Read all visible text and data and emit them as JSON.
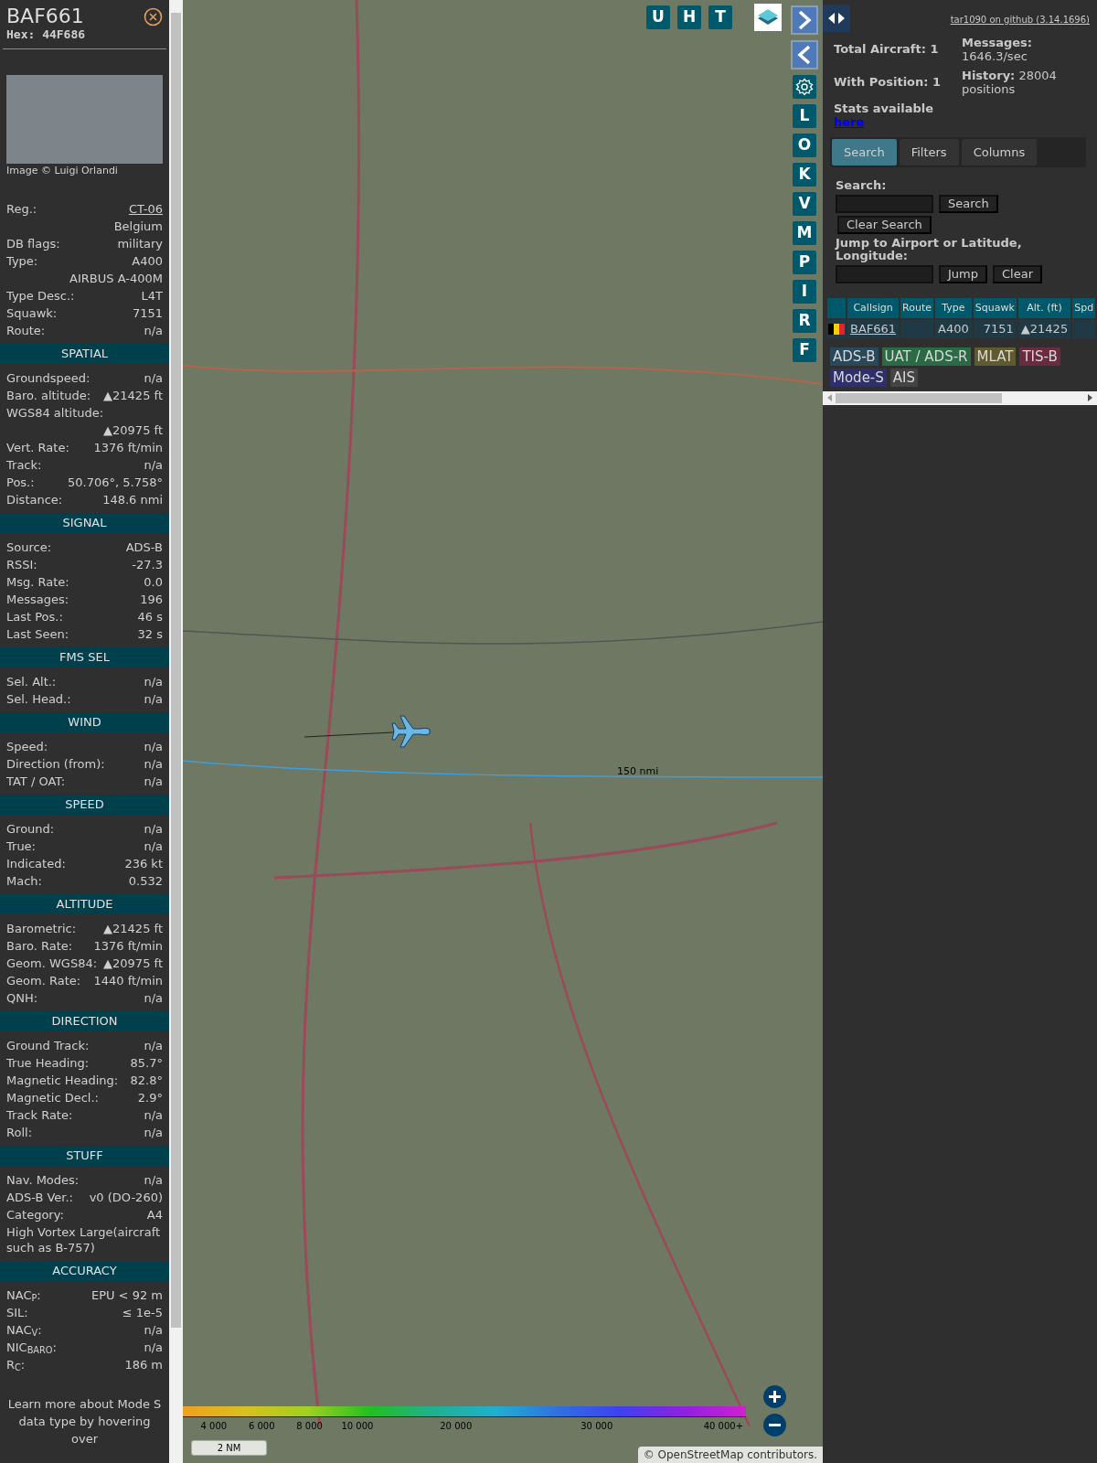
{
  "detail": {
    "callsign": "BAF661",
    "hex": "Hex: 44F686",
    "photo_credit": "Image © Luigi Orlandi",
    "rows": [
      {
        "label": "Reg.:",
        "value": "CT-06",
        "link": true
      },
      {
        "value": "Belgium"
      },
      {
        "label": "DB flags:",
        "value": "military"
      },
      {
        "label": "Type:",
        "value": "A400"
      },
      {
        "value": "AIRBUS A-400M"
      },
      {
        "label": "Type Desc.:",
        "value": "L4T"
      },
      {
        "label": "Squawk:",
        "value": "7151"
      },
      {
        "label": "Route:",
        "value": "n/a"
      }
    ],
    "sections": [
      {
        "title": "SPATIAL",
        "rows": [
          {
            "label": "Groundspeed:",
            "value": "n/a"
          },
          {
            "label": "Baro. altitude:",
            "value": "▲21425 ft"
          },
          {
            "label": "WGS84 altitude:"
          },
          {
            "value": "▲20975 ft"
          },
          {
            "label": "Vert. Rate:",
            "value": "1376 ft/min"
          },
          {
            "label": "Track:",
            "value": "n/a"
          },
          {
            "label": "Pos.:",
            "value": "50.706°, 5.758°"
          },
          {
            "label": "Distance:",
            "value": "148.6 nmi"
          }
        ]
      },
      {
        "title": "SIGNAL",
        "rows": [
          {
            "label": "Source:",
            "value": "ADS-B"
          },
          {
            "label": "RSSI:",
            "value": "-27.3"
          },
          {
            "label": "Msg. Rate:",
            "value": "0.0"
          },
          {
            "label": "Messages:",
            "value": "196"
          },
          {
            "label": "Last Pos.:",
            "value": "46 s"
          },
          {
            "label": "Last Seen:",
            "value": "32 s"
          }
        ]
      },
      {
        "title": "FMS SEL",
        "rows": [
          {
            "label": "Sel. Alt.:",
            "value": "n/a"
          },
          {
            "label": "Sel. Head.:",
            "value": "n/a"
          }
        ]
      },
      {
        "title": "WIND",
        "rows": [
          {
            "label": "Speed:",
            "value": "n/a"
          },
          {
            "label": "Direction (from):",
            "value": "n/a"
          },
          {
            "label": "TAT / OAT:",
            "value": "n/a"
          }
        ]
      },
      {
        "title": "SPEED",
        "rows": [
          {
            "label": "Ground:",
            "value": "n/a"
          },
          {
            "label": "True:",
            "value": "n/a"
          },
          {
            "label": "Indicated:",
            "value": "236 kt"
          },
          {
            "label": "Mach:",
            "value": "0.532"
          }
        ]
      },
      {
        "title": "ALTITUDE",
        "rows": [
          {
            "label": "Barometric:",
            "value": "▲21425 ft"
          },
          {
            "label": "Baro. Rate:",
            "value": "1376 ft/min"
          },
          {
            "label": "Geom. WGS84:",
            "value": "▲20975 ft"
          },
          {
            "label": "Geom. Rate:",
            "value": "1440 ft/min"
          },
          {
            "label": "QNH:",
            "value": "n/a"
          }
        ]
      },
      {
        "title": "DIRECTION",
        "rows": [
          {
            "label": "Ground Track:",
            "value": "n/a"
          },
          {
            "label": "True Heading:",
            "value": "85.7°"
          },
          {
            "label": "Magnetic Heading:",
            "value": "82.8°"
          },
          {
            "label": "Magnetic Decl.:",
            "value": "2.9°"
          },
          {
            "label": "Track Rate:",
            "value": "n/a"
          },
          {
            "label": "Roll:",
            "value": "n/a"
          }
        ]
      },
      {
        "title": "STUFF",
        "rows": [
          {
            "label": "Nav. Modes:",
            "value": "n/a"
          },
          {
            "label": "ADS-B Ver.:",
            "value": "v0 (DO-260)"
          },
          {
            "label": "Category:",
            "value": "A4"
          },
          {
            "label": "High Vortex Large(aircraft such as B-757)"
          }
        ]
      },
      {
        "title": "ACCURACY",
        "rows": [
          {
            "label": "NAC$_{P}$:",
            "value": "EPU < 92 m"
          },
          {
            "label": "SIL:",
            "value": "≤ 1e-5"
          },
          {
            "label": "NAC$_{V}$:",
            "value": "n/a"
          },
          {
            "label": "NIC$_{BARO}$:",
            "value": "n/a"
          },
          {
            "label": "R$_{C}$:",
            "value": "186 m"
          }
        ]
      }
    ],
    "footer": "Learn more about Mode S data type by hovering over"
  },
  "map": {
    "top_buttons": [
      "U",
      "H",
      "T"
    ],
    "side_buttons": [
      "L",
      "O",
      "K",
      "V",
      "M",
      "P",
      "I",
      "R",
      "F"
    ],
    "range_label": "150 nmi",
    "legend_ticks": [
      "4 000",
      "6 000",
      "8 000",
      "10 000",
      "20 000",
      "30 000",
      "40 000+"
    ],
    "scale": "2 NM",
    "attribution": "© OpenStreetMap contributors."
  },
  "panel": {
    "github": "tar1090 on github (3.14.1696)",
    "total": "Total Aircraft: 1",
    "with_position": "With Position: 1",
    "messages": "**Messages:** 1646.3/sec",
    "history": "**History:** 28004 positions",
    "stats": "Stats available",
    "stats_link": "here",
    "tabs": [
      {
        "label": "Search",
        "selected": true
      },
      {
        "label": "Filters",
        "selected": false
      },
      {
        "label": "Columns",
        "selected": false
      }
    ],
    "search_label": "Search:",
    "search_button": "Search",
    "clear_search": "Clear Search",
    "jump_label": "Jump to Airport or Latitude, Longitude:",
    "jump_button": "Jump",
    "clear_button": "Clear",
    "table": {
      "columns": [
        "Callsign",
        "Route",
        "Type",
        "Squawk",
        "Alt. (ft)",
        "Spd"
      ],
      "rows": [
        {
          "cells": [
            "BAF661",
            "",
            "A400",
            "7151",
            "▲21425",
            ""
          ]
        }
      ]
    },
    "sources": [
      {
        "label": "ADS-B",
        "color": "#29495a"
      },
      {
        "label": "UAT / ADS-R",
        "color": "#2a6a44"
      },
      {
        "label": "MLAT",
        "color": "#5f5a30"
      },
      {
        "label": "TIS-B",
        "color": "#6a2a3f"
      },
      {
        "label": "Mode-S",
        "color": "#2f2f6a"
      },
      {
        "label": "AIS",
        "color": "#444444"
      }
    ]
  }
}
